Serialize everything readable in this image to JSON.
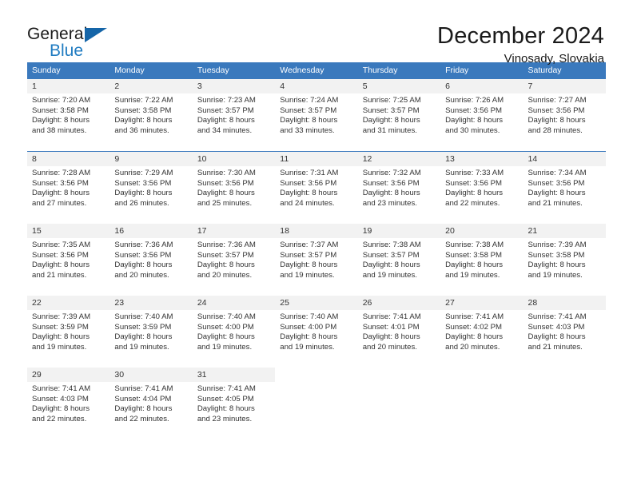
{
  "brand": {
    "name_top": "General",
    "name_bottom": "Blue",
    "accent_color": "#1f7bc1",
    "triangle_color": "#1565a8"
  },
  "header": {
    "title": "December 2024",
    "subtitle": "Vinosady, Slovakia"
  },
  "calendar": {
    "header_bg": "#3a79bd",
    "header_text_color": "#ffffff",
    "daynum_band_bg": "#f2f2f2",
    "weekdays": [
      "Sunday",
      "Monday",
      "Tuesday",
      "Wednesday",
      "Thursday",
      "Friday",
      "Saturday"
    ],
    "weeks": [
      [
        {
          "day": "1",
          "sunrise": "Sunrise: 7:20 AM",
          "sunset": "Sunset: 3:58 PM",
          "daylight": "Daylight: 8 hours",
          "daylight2": "and 38 minutes."
        },
        {
          "day": "2",
          "sunrise": "Sunrise: 7:22 AM",
          "sunset": "Sunset: 3:58 PM",
          "daylight": "Daylight: 8 hours",
          "daylight2": "and 36 minutes."
        },
        {
          "day": "3",
          "sunrise": "Sunrise: 7:23 AM",
          "sunset": "Sunset: 3:57 PM",
          "daylight": "Daylight: 8 hours",
          "daylight2": "and 34 minutes."
        },
        {
          "day": "4",
          "sunrise": "Sunrise: 7:24 AM",
          "sunset": "Sunset: 3:57 PM",
          "daylight": "Daylight: 8 hours",
          "daylight2": "and 33 minutes."
        },
        {
          "day": "5",
          "sunrise": "Sunrise: 7:25 AM",
          "sunset": "Sunset: 3:57 PM",
          "daylight": "Daylight: 8 hours",
          "daylight2": "and 31 minutes."
        },
        {
          "day": "6",
          "sunrise": "Sunrise: 7:26 AM",
          "sunset": "Sunset: 3:56 PM",
          "daylight": "Daylight: 8 hours",
          "daylight2": "and 30 minutes."
        },
        {
          "day": "7",
          "sunrise": "Sunrise: 7:27 AM",
          "sunset": "Sunset: 3:56 PM",
          "daylight": "Daylight: 8 hours",
          "daylight2": "and 28 minutes."
        }
      ],
      [
        {
          "day": "8",
          "sunrise": "Sunrise: 7:28 AM",
          "sunset": "Sunset: 3:56 PM",
          "daylight": "Daylight: 8 hours",
          "daylight2": "and 27 minutes."
        },
        {
          "day": "9",
          "sunrise": "Sunrise: 7:29 AM",
          "sunset": "Sunset: 3:56 PM",
          "daylight": "Daylight: 8 hours",
          "daylight2": "and 26 minutes."
        },
        {
          "day": "10",
          "sunrise": "Sunrise: 7:30 AM",
          "sunset": "Sunset: 3:56 PM",
          "daylight": "Daylight: 8 hours",
          "daylight2": "and 25 minutes."
        },
        {
          "day": "11",
          "sunrise": "Sunrise: 7:31 AM",
          "sunset": "Sunset: 3:56 PM",
          "daylight": "Daylight: 8 hours",
          "daylight2": "and 24 minutes."
        },
        {
          "day": "12",
          "sunrise": "Sunrise: 7:32 AM",
          "sunset": "Sunset: 3:56 PM",
          "daylight": "Daylight: 8 hours",
          "daylight2": "and 23 minutes."
        },
        {
          "day": "13",
          "sunrise": "Sunrise: 7:33 AM",
          "sunset": "Sunset: 3:56 PM",
          "daylight": "Daylight: 8 hours",
          "daylight2": "and 22 minutes."
        },
        {
          "day": "14",
          "sunrise": "Sunrise: 7:34 AM",
          "sunset": "Sunset: 3:56 PM",
          "daylight": "Daylight: 8 hours",
          "daylight2": "and 21 minutes."
        }
      ],
      [
        {
          "day": "15",
          "sunrise": "Sunrise: 7:35 AM",
          "sunset": "Sunset: 3:56 PM",
          "daylight": "Daylight: 8 hours",
          "daylight2": "and 21 minutes."
        },
        {
          "day": "16",
          "sunrise": "Sunrise: 7:36 AM",
          "sunset": "Sunset: 3:56 PM",
          "daylight": "Daylight: 8 hours",
          "daylight2": "and 20 minutes."
        },
        {
          "day": "17",
          "sunrise": "Sunrise: 7:36 AM",
          "sunset": "Sunset: 3:57 PM",
          "daylight": "Daylight: 8 hours",
          "daylight2": "and 20 minutes."
        },
        {
          "day": "18",
          "sunrise": "Sunrise: 7:37 AM",
          "sunset": "Sunset: 3:57 PM",
          "daylight": "Daylight: 8 hours",
          "daylight2": "and 19 minutes."
        },
        {
          "day": "19",
          "sunrise": "Sunrise: 7:38 AM",
          "sunset": "Sunset: 3:57 PM",
          "daylight": "Daylight: 8 hours",
          "daylight2": "and 19 minutes."
        },
        {
          "day": "20",
          "sunrise": "Sunrise: 7:38 AM",
          "sunset": "Sunset: 3:58 PM",
          "daylight": "Daylight: 8 hours",
          "daylight2": "and 19 minutes."
        },
        {
          "day": "21",
          "sunrise": "Sunrise: 7:39 AM",
          "sunset": "Sunset: 3:58 PM",
          "daylight": "Daylight: 8 hours",
          "daylight2": "and 19 minutes."
        }
      ],
      [
        {
          "day": "22",
          "sunrise": "Sunrise: 7:39 AM",
          "sunset": "Sunset: 3:59 PM",
          "daylight": "Daylight: 8 hours",
          "daylight2": "and 19 minutes."
        },
        {
          "day": "23",
          "sunrise": "Sunrise: 7:40 AM",
          "sunset": "Sunset: 3:59 PM",
          "daylight": "Daylight: 8 hours",
          "daylight2": "and 19 minutes."
        },
        {
          "day": "24",
          "sunrise": "Sunrise: 7:40 AM",
          "sunset": "Sunset: 4:00 PM",
          "daylight": "Daylight: 8 hours",
          "daylight2": "and 19 minutes."
        },
        {
          "day": "25",
          "sunrise": "Sunrise: 7:40 AM",
          "sunset": "Sunset: 4:00 PM",
          "daylight": "Daylight: 8 hours",
          "daylight2": "and 19 minutes."
        },
        {
          "day": "26",
          "sunrise": "Sunrise: 7:41 AM",
          "sunset": "Sunset: 4:01 PM",
          "daylight": "Daylight: 8 hours",
          "daylight2": "and 20 minutes."
        },
        {
          "day": "27",
          "sunrise": "Sunrise: 7:41 AM",
          "sunset": "Sunset: 4:02 PM",
          "daylight": "Daylight: 8 hours",
          "daylight2": "and 20 minutes."
        },
        {
          "day": "28",
          "sunrise": "Sunrise: 7:41 AM",
          "sunset": "Sunset: 4:03 PM",
          "daylight": "Daylight: 8 hours",
          "daylight2": "and 21 minutes."
        }
      ],
      [
        {
          "day": "29",
          "sunrise": "Sunrise: 7:41 AM",
          "sunset": "Sunset: 4:03 PM",
          "daylight": "Daylight: 8 hours",
          "daylight2": "and 22 minutes."
        },
        {
          "day": "30",
          "sunrise": "Sunrise: 7:41 AM",
          "sunset": "Sunset: 4:04 PM",
          "daylight": "Daylight: 8 hours",
          "daylight2": "and 22 minutes."
        },
        {
          "day": "31",
          "sunrise": "Sunrise: 7:41 AM",
          "sunset": "Sunset: 4:05 PM",
          "daylight": "Daylight: 8 hours",
          "daylight2": "and 23 minutes."
        },
        {
          "day": "",
          "sunrise": "",
          "sunset": "",
          "daylight": "",
          "daylight2": ""
        },
        {
          "day": "",
          "sunrise": "",
          "sunset": "",
          "daylight": "",
          "daylight2": ""
        },
        {
          "day": "",
          "sunrise": "",
          "sunset": "",
          "daylight": "",
          "daylight2": ""
        },
        {
          "day": "",
          "sunrise": "",
          "sunset": "",
          "daylight": "",
          "daylight2": ""
        }
      ]
    ]
  }
}
